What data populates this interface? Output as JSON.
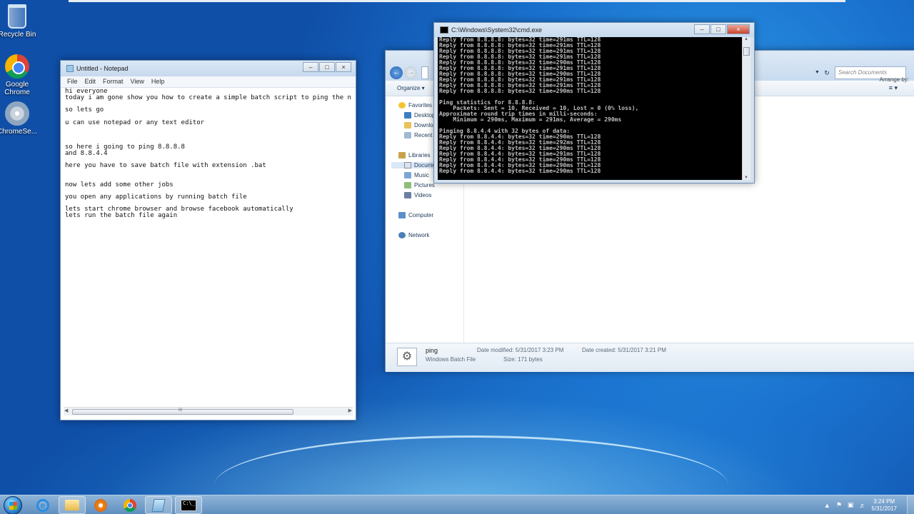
{
  "desktop": {
    "icons": [
      {
        "label": "Recycle Bin",
        "icon": "recycle-bin-icon"
      },
      {
        "label": "Google Chrome",
        "icon": "chrome-icon"
      },
      {
        "label": "ChromeSe...",
        "icon": "setup-disc-icon"
      }
    ]
  },
  "notepad": {
    "title": "Untitled - Notepad",
    "menu": [
      "File",
      "Edit",
      "Format",
      "View",
      "Help"
    ],
    "content": "hi everyone\ntoday i am gone show you how to create a simple batch script to ping the n\n\nso lets go\n\nu can use notepad or any text editor\n\n\n\nso here i going to ping 8.8.8.8\nand 8.8.4.4\n\nhere you have to save batch file with extension .bat\n\n\nnow lets add some other jobs\n\nyou open any applications by running batch file\n\nlets start chrome browser and browse facebook automatically\nlets run the batch file again",
    "scroll_mark": "III"
  },
  "cmd": {
    "title": "C:\\Windows\\System32\\cmd.exe",
    "output": "Reply from 8.8.8.8: bytes=32 time=291ms TTL=128\nReply from 8.8.8.8: bytes=32 time=291ms TTL=128\nReply from 8.8.8.8: bytes=32 time=291ms TTL=128\nReply from 8.8.8.8: bytes=32 time=291ms TTL=128\nReply from 8.8.8.8: bytes=32 time=290ms TTL=128\nReply from 8.8.8.8: bytes=32 time=291ms TTL=128\nReply from 8.8.8.8: bytes=32 time=290ms TTL=128\nReply from 8.8.8.8: bytes=32 time=291ms TTL=128\nReply from 8.8.8.8: bytes=32 time=291ms TTL=128\nReply from 8.8.8.8: bytes=32 time=290ms TTL=128\n\nPing statistics for 8.8.8.8:\n    Packets: Sent = 10, Received = 10, Lost = 0 (0% loss),\nApproximate round trip times in milli-seconds:\n    Minimum = 290ms, Maximum = 291ms, Average = 290ms\n\nPinging 8.8.4.4 with 32 bytes of data:\nReply from 8.8.4.4: bytes=32 time=290ms TTL=128\nReply from 8.8.4.4: bytes=32 time=292ms TTL=128\nReply from 8.8.4.4: bytes=32 time=290ms TTL=128\nReply from 8.8.4.4: bytes=32 time=291ms TTL=128\nReply from 8.8.4.4: bytes=32 time=290ms TTL=128\nReply from 8.8.4.4: bytes=32 time=290ms TTL=128\nReply from 8.8.4.4: bytes=32 time=290ms TTL=128"
  },
  "explorer": {
    "search_placeholder": "Search Documents",
    "organize": "Organize ▾",
    "arrange_by": "Arrange by:",
    "nav": {
      "favorites": "Favorites",
      "desktop": "Desktop",
      "downloads": "Downlo...",
      "recent": "Recent P...",
      "libraries": "Libraries",
      "documents": "Docume...",
      "music": "Music",
      "pictures": "Pictures",
      "videos": "Videos",
      "computer": "Computer",
      "network": "Network"
    },
    "details": {
      "name": "ping",
      "type": "Windows Batch File",
      "date_modified": "Date modified: 5/31/2017 3:23 PM",
      "size": "Size: 171 bytes",
      "date_created": "Date created: 5/31/2017 3:21 PM"
    }
  },
  "taskbar": {
    "apps": [
      "internet-explorer",
      "windows-explorer",
      "media-player",
      "google-chrome",
      "notepad",
      "command-prompt"
    ],
    "cmd_icon_text": "C:\\_",
    "clock_time": "3:24 PM",
    "clock_date": "5/31/2017"
  }
}
